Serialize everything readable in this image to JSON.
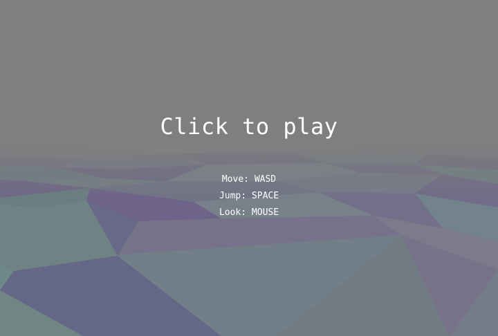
{
  "overlay": {
    "title": "Click to play",
    "controls": [
      {
        "label": "Move: WASD"
      },
      {
        "label": "Jump: SPACE"
      },
      {
        "label": "Look: MOUSE"
      }
    ]
  },
  "colors": {
    "sky": "#7f7f7f",
    "text": "#ffffff",
    "terrain_purple": "#6a5f8c",
    "terrain_teal": "#66867f",
    "terrain_slate": "#707a86"
  }
}
